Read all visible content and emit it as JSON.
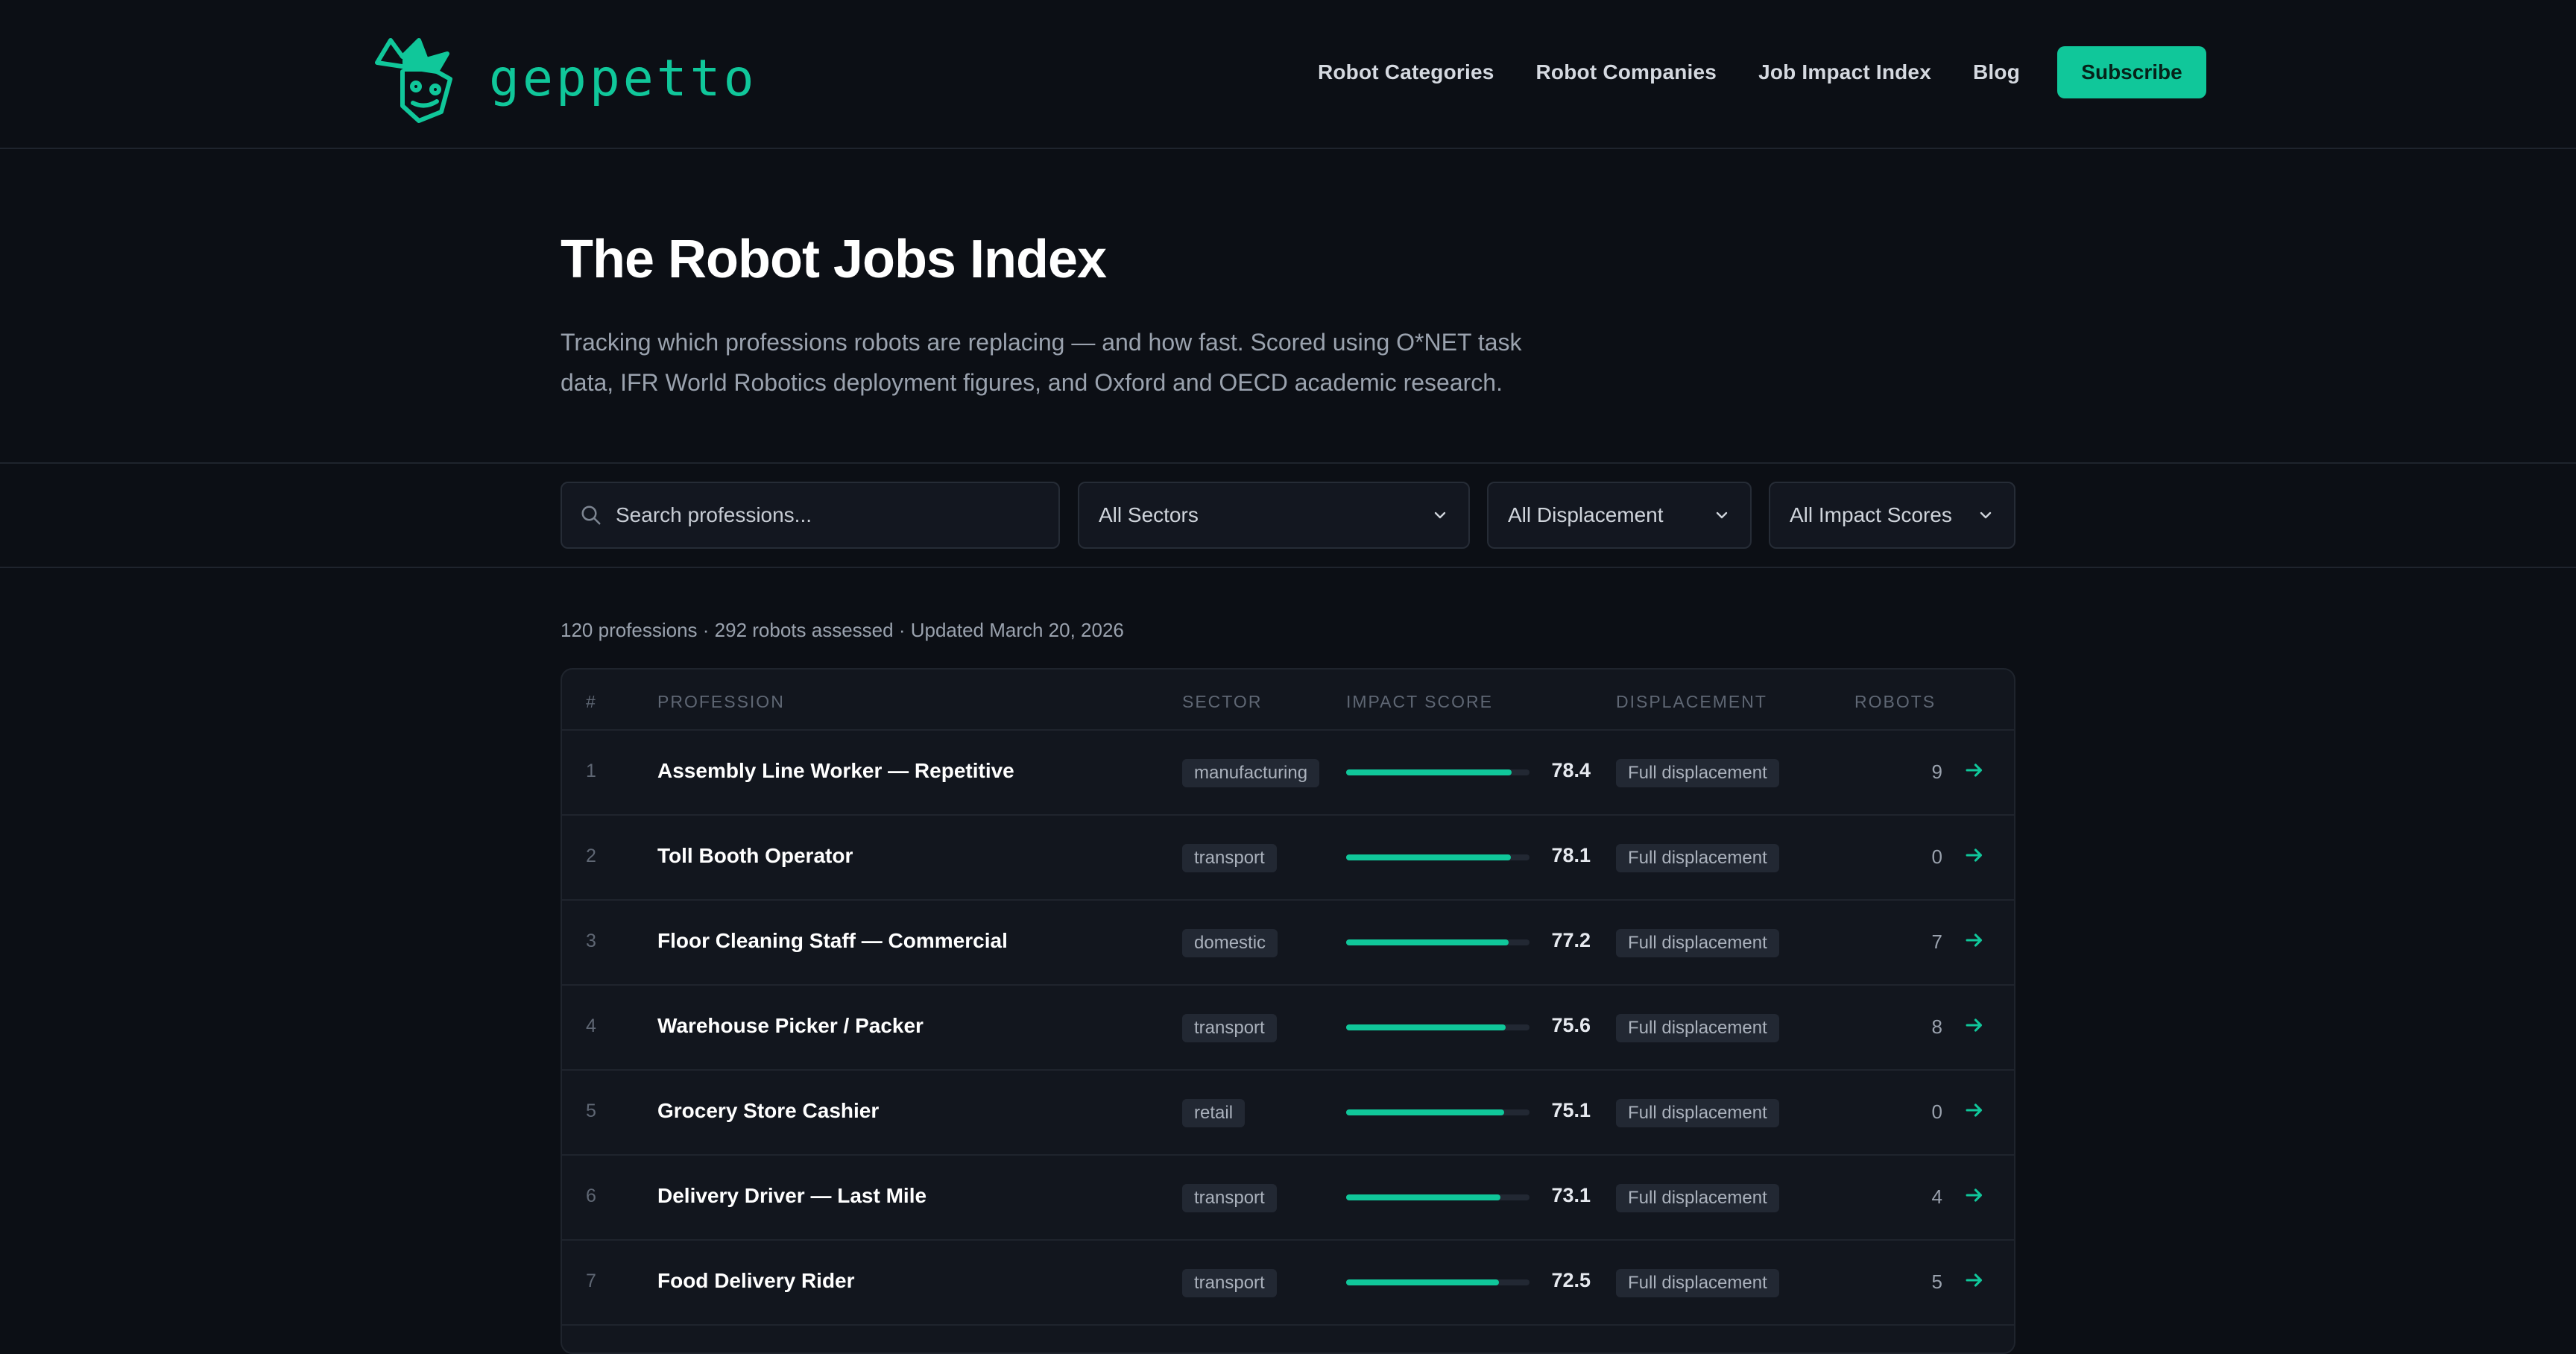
{
  "header": {
    "logo_text": "geppetto",
    "nav": [
      "Robot Categories",
      "Robot Companies",
      "Job Impact Index",
      "Blog"
    ],
    "subscribe_label": "Subscribe"
  },
  "hero": {
    "title": "The Robot Jobs Index",
    "description_line1": "Tracking which professions robots are replacing — and how fast. Scored using O*NET task",
    "description_line2": "data, IFR World Robotics deployment figures, and Oxford and OECD academic research."
  },
  "filters": {
    "search_placeholder": "Search professions...",
    "sector": "All Sectors",
    "displacement": "All Displacement",
    "impact": "All Impact Scores"
  },
  "meta": "120 professions · 292 robots assessed · Updated March 20, 2026",
  "table": {
    "headers": {
      "num": "#",
      "profession": "PROFESSION",
      "sector": "SECTOR",
      "impact": "IMPACT SCORE",
      "displacement": "DISPLACEMENT",
      "robots": "ROBOTS"
    },
    "rows": [
      {
        "num": "1",
        "profession": "Assembly Line Worker — Repetitive",
        "sector": "manufacturing",
        "score": "78.4",
        "displacement": "Full displacement",
        "robots": "9"
      },
      {
        "num": "2",
        "profession": "Toll Booth Operator",
        "sector": "transport",
        "score": "78.1",
        "displacement": "Full displacement",
        "robots": "0"
      },
      {
        "num": "3",
        "profession": "Floor Cleaning Staff — Commercial",
        "sector": "domestic",
        "score": "77.2",
        "displacement": "Full displacement",
        "robots": "7"
      },
      {
        "num": "4",
        "profession": "Warehouse Picker / Packer",
        "sector": "transport",
        "score": "75.6",
        "displacement": "Full displacement",
        "robots": "8"
      },
      {
        "num": "5",
        "profession": "Grocery Store Cashier",
        "sector": "retail",
        "score": "75.1",
        "displacement": "Full displacement",
        "robots": "0"
      },
      {
        "num": "6",
        "profession": "Delivery Driver — Last Mile",
        "sector": "transport",
        "score": "73.1",
        "displacement": "Full displacement",
        "robots": "4"
      },
      {
        "num": "7",
        "profession": "Food Delivery Rider",
        "sector": "transport",
        "score": "72.5",
        "displacement": "Full displacement",
        "robots": "5"
      },
      {
        "num": "",
        "profession": "",
        "sector": "",
        "score": "",
        "displacement": "",
        "robots": ""
      }
    ]
  },
  "colors": {
    "accent": "#10c79a",
    "background": "#0c0f15",
    "table_bg": "#12161e"
  },
  "icons": {
    "logo": "geppetto-mascot-icon",
    "search": "search-icon",
    "chevron": "chevron-down-icon",
    "row_arrow": "arrow-right-icon"
  }
}
